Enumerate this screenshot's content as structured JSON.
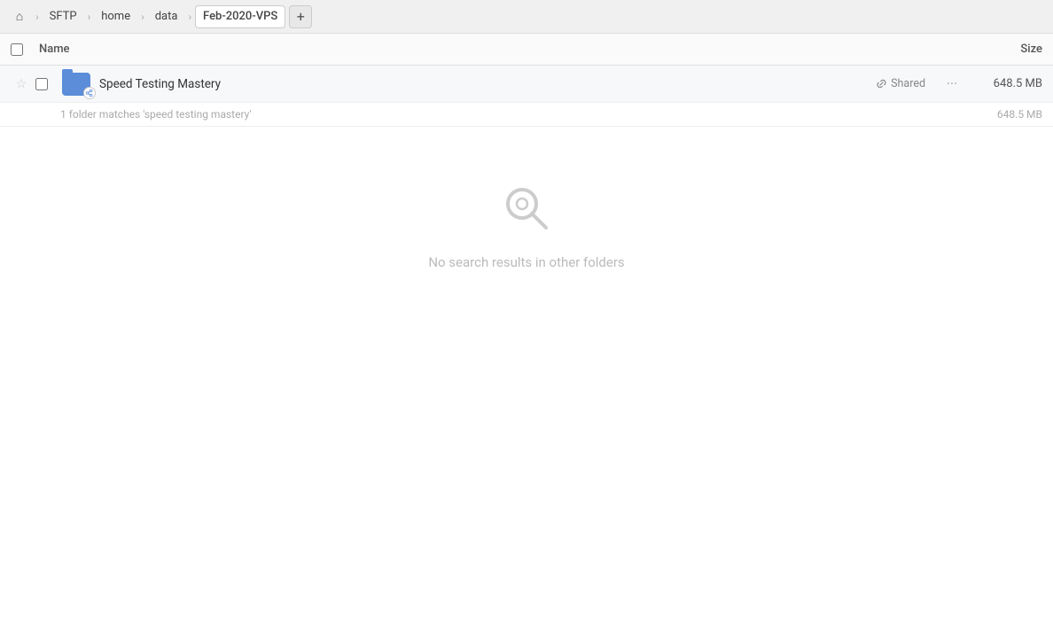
{
  "breadcrumb": {
    "home_icon": "⌂",
    "items": [
      {
        "label": "SFTP",
        "active": false
      },
      {
        "label": "home",
        "active": false
      },
      {
        "label": "data",
        "active": false
      },
      {
        "label": "Feb-2020-VPS",
        "active": true
      }
    ],
    "add_label": "+"
  },
  "columns": {
    "name_label": "Name",
    "size_label": "Size"
  },
  "file_row": {
    "name": "Speed Testing Mastery",
    "shared_label": "Shared",
    "size": "648.5 MB",
    "starred": false
  },
  "matches_info": {
    "text": "1 folder matches 'speed testing mastery'",
    "size": "648.5 MB"
  },
  "empty_state": {
    "message": "No search results in other folders"
  }
}
